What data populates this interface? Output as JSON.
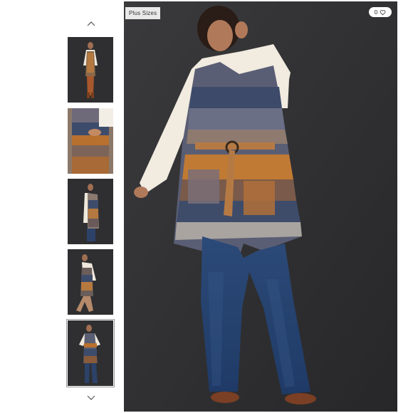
{
  "gallery": {
    "badge_text": "Plus Sizes",
    "like_count": "0",
    "icons": {
      "up": "chevron-up-icon",
      "down": "chevron-down-icon",
      "like": "heart-icon"
    },
    "thumbnails": [
      {
        "view": "full-front"
      },
      {
        "view": "detail-pockets"
      },
      {
        "view": "side"
      },
      {
        "view": "walking"
      },
      {
        "view": "full-front-selected"
      }
    ],
    "selected_index": 4
  }
}
